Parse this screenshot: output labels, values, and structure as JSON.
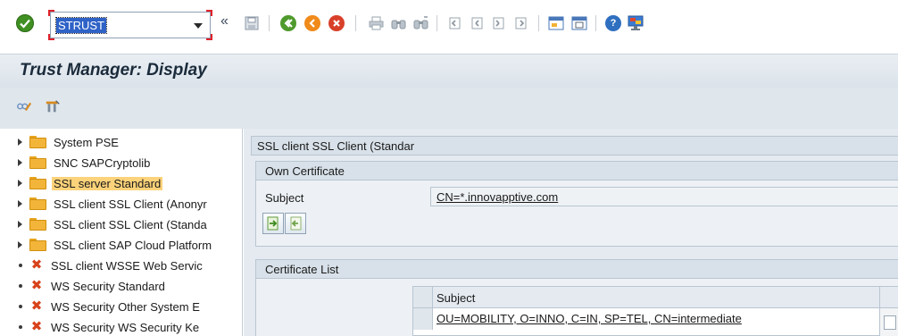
{
  "toolbar": {
    "command_value": "STRUST",
    "collapse_glyph": "«",
    "icons": [
      "check-icon",
      "save-icon",
      "back-icon",
      "exit-icon",
      "cancel-icon",
      "print-icon",
      "find-icon",
      "find-next-icon",
      "first-page-icon",
      "previous-page-icon",
      "next-page-icon",
      "last-page-icon",
      "create-session-icon",
      "shortcut-icon",
      "help-icon",
      "customize-layout-icon"
    ]
  },
  "title": "Trust Manager: Display",
  "app_toolbar": {
    "icons": [
      "display-change-icon",
      "environment-icon"
    ]
  },
  "tree": {
    "items": [
      {
        "label": "System PSE",
        "kind": "folder"
      },
      {
        "label": "SNC SAPCryptolib",
        "kind": "folder"
      },
      {
        "label": "SSL server Standard",
        "kind": "folder",
        "selected": true
      },
      {
        "label": "SSL client SSL Client (Anonyr",
        "kind": "folder"
      },
      {
        "label": "SSL client SSL Client (Standa",
        "kind": "folder"
      },
      {
        "label": "SSL client SAP Cloud Platform",
        "kind": "folder"
      },
      {
        "label": "SSL client WSSE Web Servic",
        "kind": "missing"
      },
      {
        "label": "WS Security Standard",
        "kind": "missing"
      },
      {
        "label": "WS Security Other System E",
        "kind": "missing"
      },
      {
        "label": "WS Security WS Security Ke",
        "kind": "missing"
      }
    ]
  },
  "detail": {
    "header": "SSL client SSL Client (Standar",
    "own_certificate": {
      "title": "Own Certificate",
      "subject_label": "Subject",
      "subject_value": "CN=*.innovapptive.com"
    },
    "certificate_list": {
      "title": "Certificate List",
      "column_header": "Subject",
      "rows": [
        "OU=MOBILITY, O=INNO, C=IN, SP=TEL, CN=intermediate"
      ]
    }
  }
}
